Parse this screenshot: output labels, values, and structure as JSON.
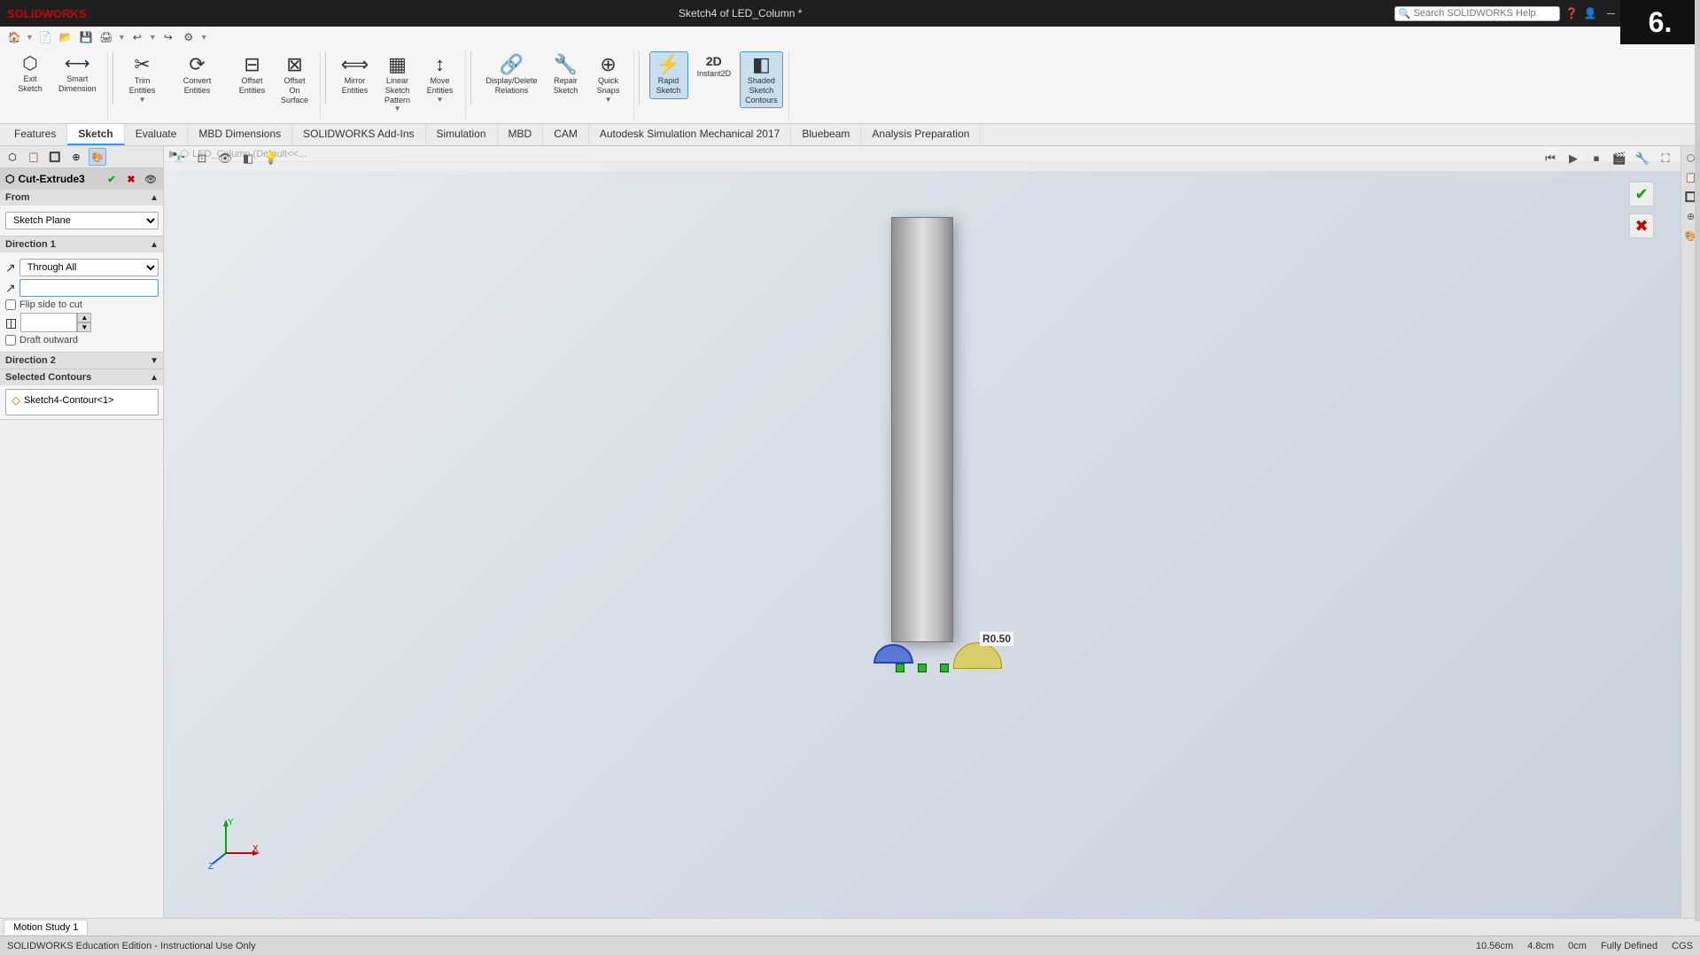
{
  "app": {
    "title": "Sketch4 of LED_Column *",
    "logo": "SOLIDWORKS",
    "number_badge": "6."
  },
  "titlebar": {
    "search_placeholder": "Search SOLIDWORKS Help",
    "controls": [
      "minimize",
      "restore",
      "maximize",
      "close"
    ]
  },
  "quick_access": {
    "buttons": [
      "home",
      "new",
      "open",
      "save",
      "print",
      "undo",
      "redo",
      "options"
    ]
  },
  "ribbon": {
    "tabs": [
      "Features",
      "Sketch",
      "Evaluate",
      "MBD Dimensions",
      "SOLIDWORKS Add-Ins",
      "Simulation",
      "MBD",
      "CAM",
      "Autodesk Simulation Mechanical 2017",
      "Bluebeam",
      "Analysis Preparation"
    ],
    "active_tab": "Sketch",
    "groups": [
      {
        "name": "sketch-group",
        "items": [
          {
            "id": "exit-sketch",
            "label": "Exit\nSketch",
            "icon": "⬡"
          },
          {
            "id": "smart-dimension",
            "label": "Smart\nDimension",
            "icon": "⟷"
          }
        ]
      },
      {
        "name": "draw-group",
        "items": [
          {
            "id": "trim-entities",
            "label": "Trim\nEntities",
            "icon": "✂"
          },
          {
            "id": "convert-entities",
            "label": "Convert\nEntities",
            "icon": "⟳"
          },
          {
            "id": "offset-entities",
            "label": "Offset\nEntities",
            "icon": "⊟"
          },
          {
            "id": "offset-on-surface",
            "label": "Offset\nOn\nSurface",
            "icon": "⊠"
          }
        ]
      },
      {
        "name": "pattern-group",
        "items": [
          {
            "id": "mirror-entities",
            "label": "Mirror Entities",
            "icon": "⟺"
          },
          {
            "id": "linear-sketch-pattern",
            "label": "Linear Sketch Pattern",
            "icon": "▦"
          },
          {
            "id": "move-entities",
            "label": "Move Entities",
            "icon": "↕"
          }
        ]
      },
      {
        "name": "relations-group",
        "items": [
          {
            "id": "display-delete-relations",
            "label": "Display/Delete\nRelations",
            "icon": "🔗"
          },
          {
            "id": "repair-sketch",
            "label": "Repair\nSketch",
            "icon": "🔧"
          },
          {
            "id": "quick-snaps",
            "label": "Quick\nSnaps",
            "icon": "⊕"
          }
        ]
      },
      {
        "name": "view-group",
        "items": [
          {
            "id": "rapid-sketch",
            "label": "Rapid\nSketch",
            "icon": "⚡",
            "active": true
          },
          {
            "id": "instant2d",
            "label": "Instant2D",
            "icon": "2D"
          },
          {
            "id": "shaded-sketch-contours",
            "label": "Shaded\nSketch\nContours",
            "icon": "◧",
            "active": true
          }
        ]
      }
    ]
  },
  "property_manager": {
    "title": "Cut-Extrude3",
    "icon": "⬡",
    "sections": {
      "from": {
        "label": "From",
        "expanded": true,
        "value": "Sketch Plane"
      },
      "direction1": {
        "label": "Direction 1",
        "expanded": true,
        "type_value": "Through All",
        "flip_side_to_cut": false,
        "draft_outward": false
      },
      "direction2": {
        "label": "Direction 2",
        "expanded": false
      },
      "selected_contours": {
        "label": "Selected Contours",
        "expanded": true,
        "items": [
          "Sketch4-Contour<1>"
        ]
      }
    }
  },
  "model_tree": {
    "path": "LED_Column (Default<<..."
  },
  "viewport": {
    "dimension_label": "R0.50",
    "coordinates": {
      "x": "10.56cm",
      "y": "4.8cm",
      "z": "0cm"
    }
  },
  "statusbar": {
    "message": "SOLIDWORKS Education Edition - Instructional Use Only",
    "coords": {
      "x": "10.56cm",
      "y": "4.8cm",
      "z": "0cm"
    },
    "state": "Fully Defined",
    "renderer": "CGS"
  },
  "bottom_tabs": [
    {
      "id": "motion-study-1",
      "label": "Motion Study 1"
    }
  ]
}
